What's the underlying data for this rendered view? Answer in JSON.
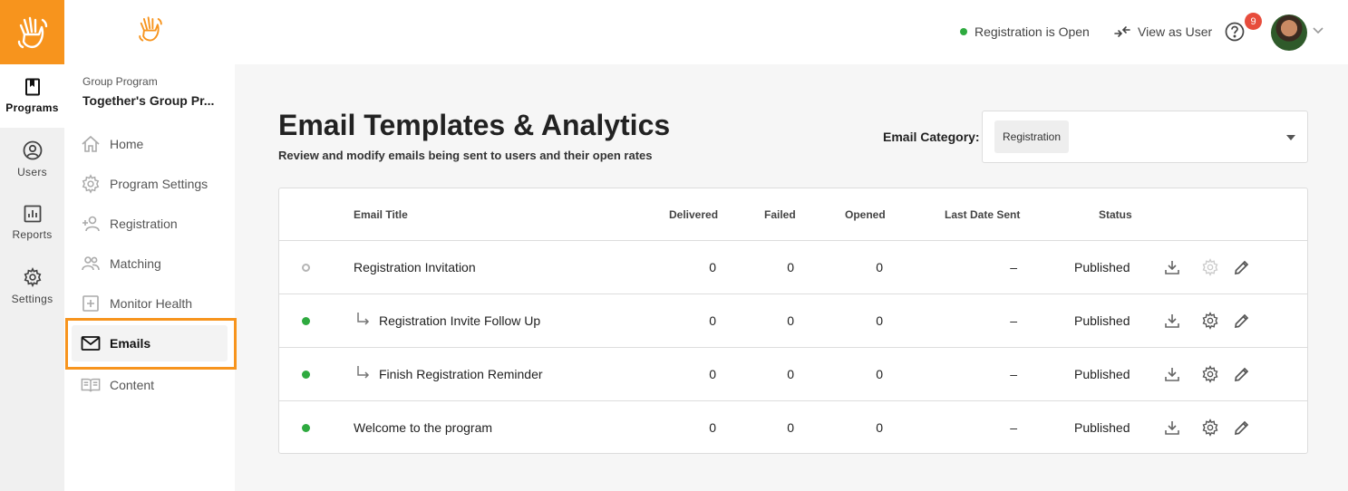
{
  "rail": {
    "items": [
      {
        "label": "Programs",
        "icon": "bookmark-icon"
      },
      {
        "label": "Users",
        "icon": "user-circle-icon"
      },
      {
        "label": "Reports",
        "icon": "bar-chart-icon"
      },
      {
        "label": "Settings",
        "icon": "gear-icon"
      }
    ]
  },
  "program": {
    "type": "Group Program",
    "name": "Together's Group Pr..."
  },
  "nav": {
    "items": [
      {
        "label": "Home",
        "icon": "home-icon"
      },
      {
        "label": "Program Settings",
        "icon": "gear-icon"
      },
      {
        "label": "Registration",
        "icon": "add-person-icon"
      },
      {
        "label": "Matching",
        "icon": "people-icon"
      },
      {
        "label": "Monitor Health",
        "icon": "medical-plus-icon"
      },
      {
        "label": "Emails",
        "icon": "envelope-icon"
      },
      {
        "label": "Content",
        "icon": "book-icon"
      }
    ],
    "active": "Emails"
  },
  "topbar": {
    "registration_status": "Registration is Open",
    "view_as_user": "View as User",
    "notification_count": "9"
  },
  "page": {
    "title": "Email Templates & Analytics",
    "subtitle": "Review and modify emails being sent to users and their open rates",
    "category_label": "Email Category:",
    "category_value": "Registration"
  },
  "table": {
    "headers": {
      "title": "Email Title",
      "delivered": "Delivered",
      "failed": "Failed",
      "opened": "Opened",
      "last_sent": "Last Date Sent",
      "status": "Status"
    },
    "rows": [
      {
        "title": "Registration Invitation",
        "delivered": "0",
        "failed": "0",
        "opened": "0",
        "last_sent": "–",
        "status": "Published",
        "active": false,
        "followup": false
      },
      {
        "title": "Registration Invite Follow Up",
        "delivered": "0",
        "failed": "0",
        "opened": "0",
        "last_sent": "–",
        "status": "Published",
        "active": true,
        "followup": true
      },
      {
        "title": "Finish Registration Reminder",
        "delivered": "0",
        "failed": "0",
        "opened": "0",
        "last_sent": "–",
        "status": "Published",
        "active": true,
        "followup": true
      },
      {
        "title": "Welcome to the program",
        "delivered": "0",
        "failed": "0",
        "opened": "0",
        "last_sent": "–",
        "status": "Published",
        "active": true,
        "followup": false
      }
    ]
  },
  "colors": {
    "brand": "#f7941d",
    "success": "#2eaa3f",
    "badge": "#e74c3c"
  }
}
